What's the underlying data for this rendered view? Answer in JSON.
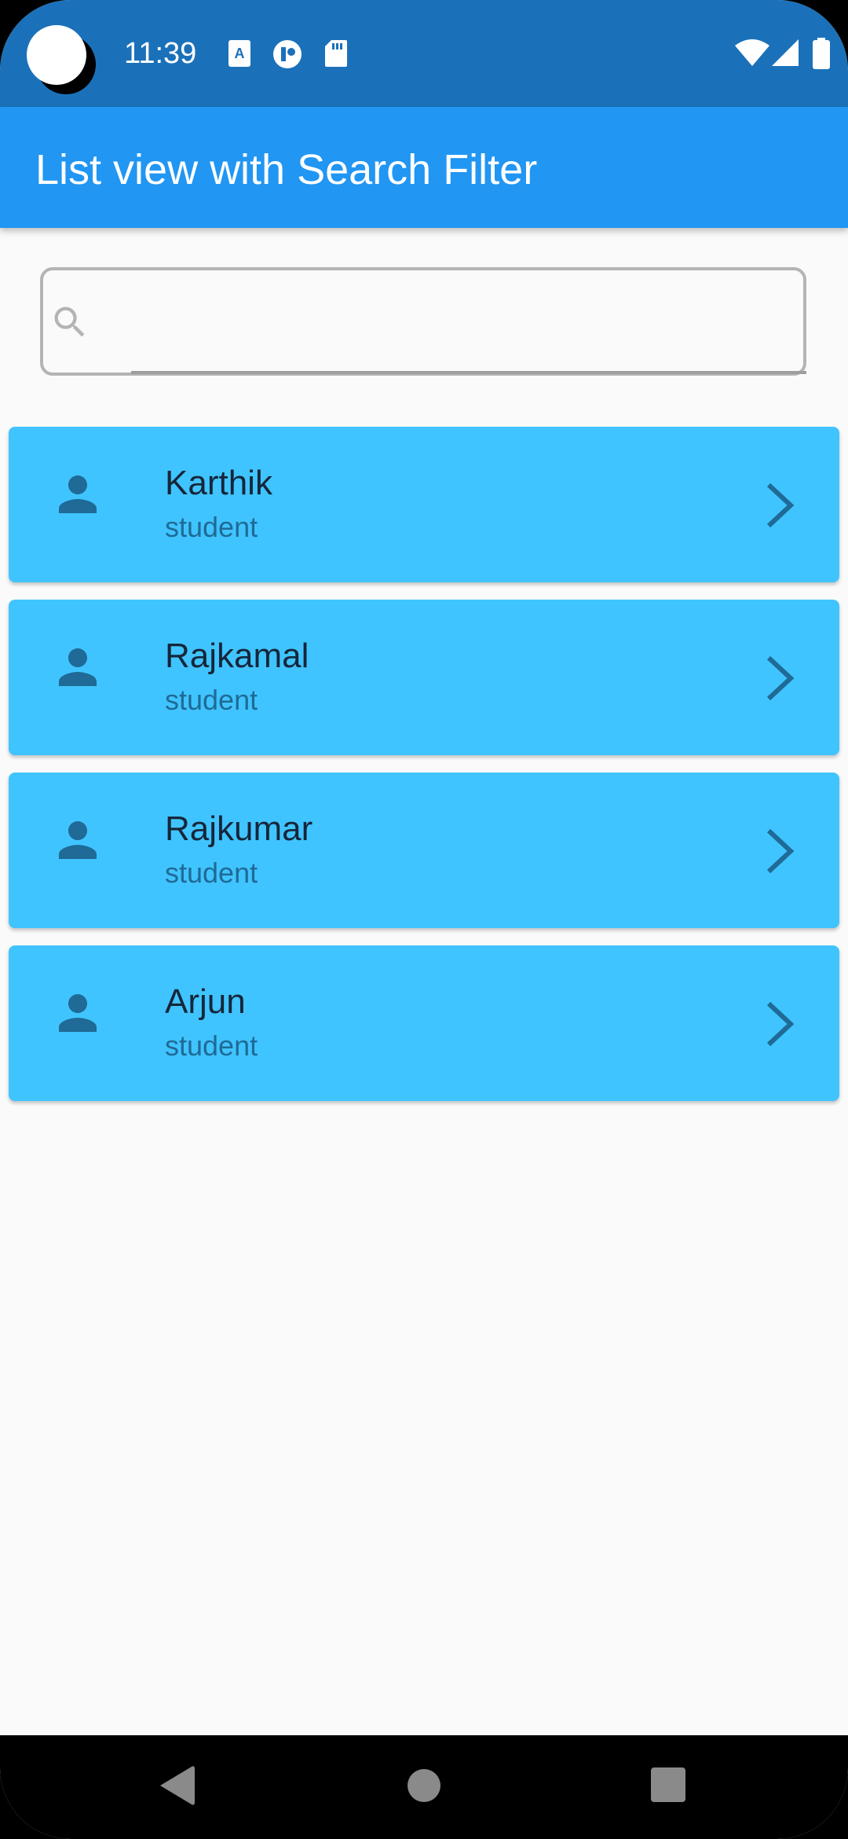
{
  "status_bar": {
    "time": "11:39",
    "icons": [
      "text-notification-icon",
      "app-notification-icon",
      "sd-card-icon",
      "wifi-icon",
      "signal-icon",
      "battery-icon"
    ]
  },
  "app_bar": {
    "title": "List view with Search Filter"
  },
  "search": {
    "value": "",
    "placeholder": ""
  },
  "list": {
    "items": [
      {
        "name": "Karthik",
        "role": "student"
      },
      {
        "name": "Rajkamal",
        "role": "student"
      },
      {
        "name": "Rajkumar",
        "role": "student"
      },
      {
        "name": "Arjun",
        "role": "student"
      }
    ]
  },
  "nav_bar": {
    "buttons": [
      "back-icon",
      "home-icon",
      "recents-icon"
    ]
  },
  "colors": {
    "status_bar": "#1b71b9",
    "app_bar": "#2196f3",
    "card": "#40c4ff",
    "icon": "#1f6a96",
    "background": "#fafafa"
  }
}
